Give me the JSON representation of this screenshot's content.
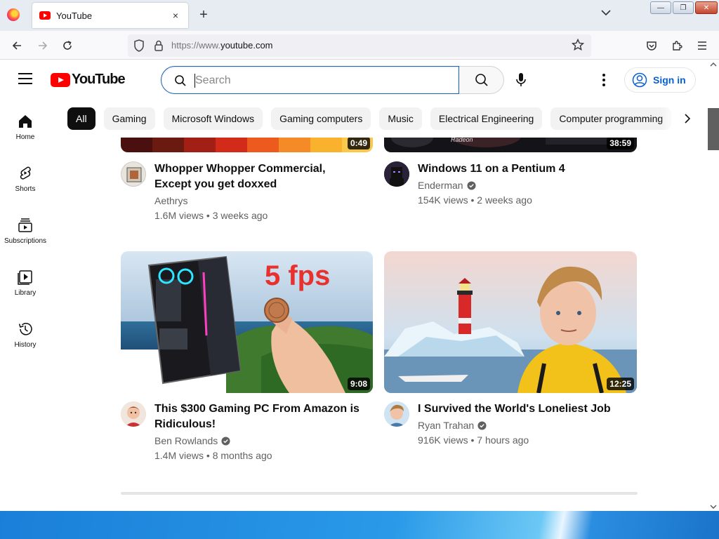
{
  "browser": {
    "tab_title": "YouTube",
    "tab_close": "×",
    "new_tab": "+",
    "tab_list": "⌄",
    "url_prefix": "https://www.",
    "url_domain": "youtube.com",
    "window_buttons": [
      "—",
      "❐",
      "✕"
    ]
  },
  "youtube": {
    "logo_text": "YouTube",
    "search_placeholder": "Search",
    "sign_in": "Sign in",
    "chips": [
      "All",
      "Gaming",
      "Microsoft Windows",
      "Gaming computers",
      "Music",
      "Electrical Engineering",
      "Computer programming"
    ],
    "sidebar": [
      {
        "label": "Home",
        "icon": "home-icon"
      },
      {
        "label": "Shorts",
        "icon": "shorts-icon"
      },
      {
        "label": "Subscriptions",
        "icon": "subscriptions-icon"
      },
      {
        "label": "Library",
        "icon": "library-icon"
      },
      {
        "label": "History",
        "icon": "history-icon"
      }
    ],
    "videos": [
      {
        "title": "Whopper Whopper Commercial, Except you get doxxed",
        "channel": "Aethrys",
        "verified": false,
        "meta": "1.6M views • 3 weeks ago",
        "duration": "0:49"
      },
      {
        "title": "Windows 11 on a Pentium 4",
        "channel": "Enderman",
        "verified": true,
        "meta": "154K views • 2 weeks ago",
        "duration": "38:59"
      },
      {
        "title": "This $300 Gaming PC From Amazon is Ridiculous!",
        "channel": "Ben Rowlands",
        "verified": true,
        "meta": "1.4M views • 8 months ago",
        "duration": "9:08",
        "thumb_text": "5 fps"
      },
      {
        "title": "I Survived the World's Loneliest Job",
        "channel": "Ryan Trahan",
        "verified": true,
        "meta": "916K views • 7 hours ago",
        "duration": "12:25"
      }
    ],
    "thumb_brand_text": "Radeon"
  },
  "colors": {
    "yt_red": "#ff0000",
    "link_blue": "#065fd4",
    "search_focus": "#1c62b9"
  }
}
